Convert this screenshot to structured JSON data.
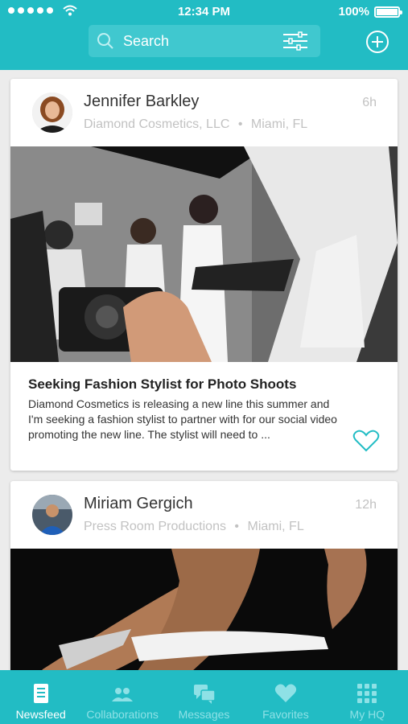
{
  "status_bar": {
    "time": "12:34 PM",
    "battery": "100%"
  },
  "search": {
    "placeholder": "Search"
  },
  "posts": [
    {
      "author": "Jennifer Barkley",
      "company": "Diamond Cosmetics, LLC",
      "location": "Miami, FL",
      "time": "6h",
      "title": "Seeking Fashion Stylist for Photo Shoots",
      "body": "Diamond Cosmetics is releasing a new line this summer and I'm seeking a fashion stylist to partner with for our social video promoting the new line. The stylist will need to ..."
    },
    {
      "author": "Miriam Gergich",
      "company": "Press Room Productions",
      "location": "Miami, FL",
      "time": "12h"
    }
  ],
  "tabs": [
    {
      "label": "Newsfeed",
      "icon": "newsfeed-icon",
      "active": true
    },
    {
      "label": "Collaborations",
      "icon": "people-icon",
      "active": false
    },
    {
      "label": "Messages",
      "icon": "chat-icon",
      "active": false
    },
    {
      "label": "Favorites",
      "icon": "heart-icon",
      "active": false
    },
    {
      "label": "My HQ",
      "icon": "grid-icon",
      "active": false
    }
  ],
  "colors": {
    "brand": "#22bcc4",
    "inactive_tab": "#8ee1e6"
  }
}
